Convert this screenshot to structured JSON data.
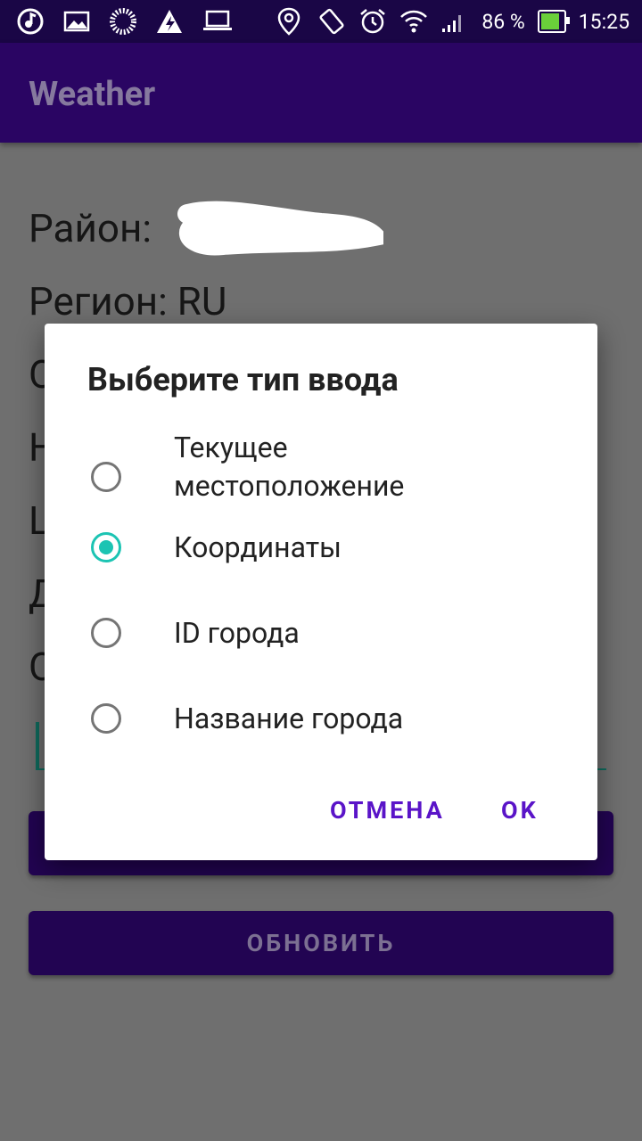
{
  "status_bar": {
    "battery": "86 %",
    "time": "15:25",
    "icons": [
      "music-icon",
      "image-icon",
      "loading-icon",
      "warning-icon",
      "laptop-icon",
      "location-icon",
      "rotate-icon",
      "alarm-icon",
      "wifi-icon",
      "signal-icon",
      "battery-icon"
    ]
  },
  "app_bar": {
    "title": "Weather"
  },
  "background": {
    "district_label": "Район:",
    "region_line": "Регион: RU",
    "line3_letter": "О",
    "line4_letter": "Н",
    "line5_letter": "L",
    "line6_letter": "Д",
    "line7_letter": "О",
    "button_hidden": "",
    "refresh_button": "ОБНОВИТЬ"
  },
  "dialog": {
    "title": "Выберите тип ввода",
    "options": [
      {
        "label": "Текущее местоположение",
        "line1": "Текущее",
        "line2": "местоположение",
        "checked": false
      },
      {
        "label": "Координаты",
        "checked": true
      },
      {
        "label": "ID города",
        "checked": false
      },
      {
        "label": "Название города",
        "checked": false
      }
    ],
    "cancel": "ОТМЕНА",
    "ok": "OK"
  },
  "colors": {
    "accent": "#1cc4b3",
    "primary": "#2a0563",
    "dialog_button": "#5a14c8"
  }
}
